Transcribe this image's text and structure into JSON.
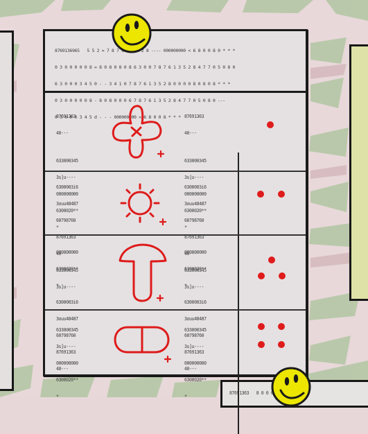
{
  "screen": {
    "accent_red": "#df1b1b",
    "pin_color": "#e8e000"
  },
  "sheet": {
    "header_lines": [
      "8769136965   5 5 2 = 7 8 7 6 1 3 5 2 8 ---- 000000000 < 6 8 0 0 8 0 * * *",
      "0 3 0 0 0 0 0 8 = 8 0 8 0 8 0 8 6 3 0 0 7 8 7 6 1 3 5 2 8 4 7 7 0 5 0 8 0",
      "6 3 0 0 0 3 4 5 0 - - 3 4 1 0 7 8 7 6 1 3 5 2 8 0 0 0 0 8 0 8 0 8 * * *",
      "0 3 0 0 0 0 0 8 - 8 0 8 0 0 0 6 7 8 7 6 1 3 5 2 8 4 7 7 0 5 0 8 0 ---",
      "0 3 0 0 0 3 4 5 d - - - 000000000 < 6 8 0 0 8 * * *"
    ],
    "rows": [
      {
        "label": "cross-rune",
        "left_code": [
          "87691363",
          "40---",
          "",
          "633000345",
          "3s]u----",
          "000000000",
          "6300020**",
          "*"
        ],
        "right_code": [
          "87691363",
          "40---",
          "",
          "633000345",
          "3s]u----",
          "000000000",
          "6300020**",
          "*"
        ],
        "dots": 1
      },
      {
        "label": "sun-rune",
        "left_code": [
          "6300003i6",
          "3ouu48487",
          "60798760",
          "87691363",
          "40---",
          "633000345",
          "3s]u----"
        ],
        "right_code": [
          "6300003i6",
          "3ouu48487",
          "60798760",
          "87691363",
          "40---",
          "633000345",
          "3s]u----"
        ],
        "dots": 2
      },
      {
        "label": "mushroom-rune",
        "left_code": [
          "000000000",
          "6300020**",
          "*",
          "6300003i6",
          "3ouu48487",
          "60798760",
          "87691363",
          "40---"
        ],
        "right_code": [
          "000000000",
          "6300020**",
          "*",
          "6300003i6",
          "3ouu48487",
          "60798760",
          "87691363",
          "40---"
        ],
        "dots": 3
      },
      {
        "label": "capsule-rune",
        "left_code": [
          "633000345",
          "3s]u----",
          "000000000",
          "6300020**",
          "*"
        ],
        "right_code": [
          "633000345",
          "3s]u----",
          "000000000",
          "6300020**",
          "*"
        ],
        "dots": 4
      }
    ]
  },
  "bottom_paper": {
    "header_text": "87691363   8 0 0 0 0 0"
  }
}
